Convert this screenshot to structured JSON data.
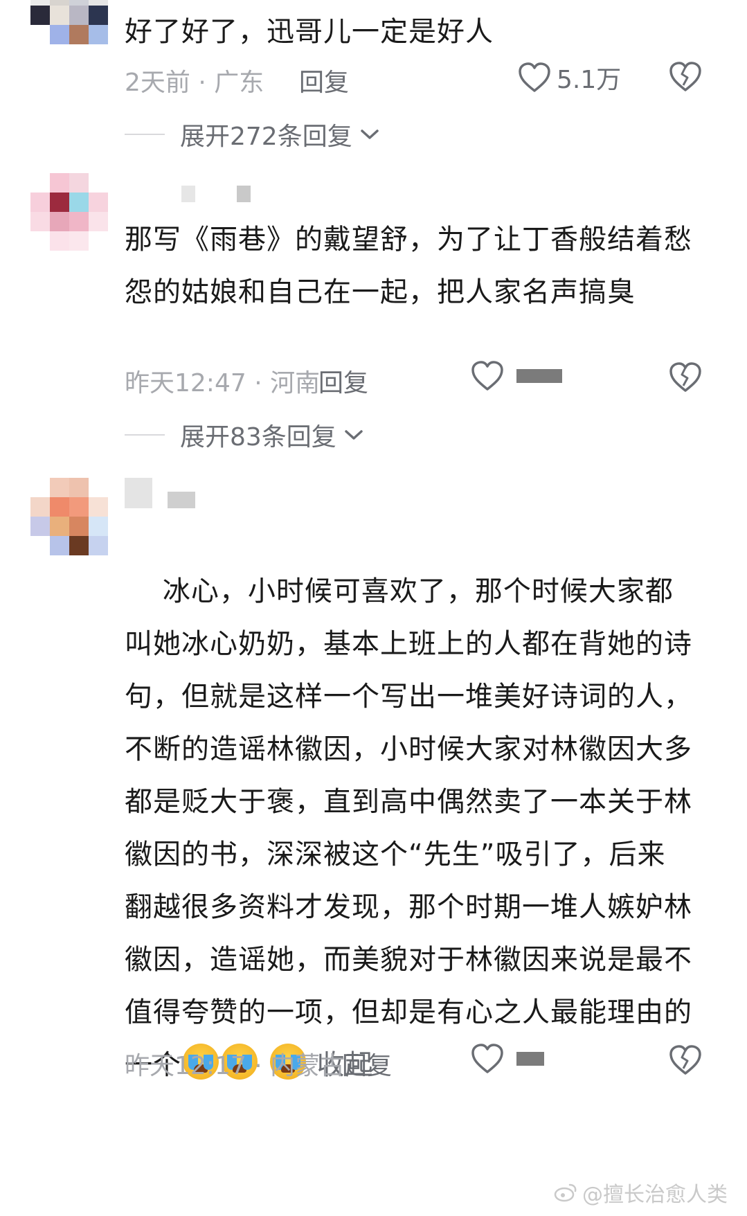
{
  "comments": [
    {
      "text": "好了好了，迅哥儿一定是好人",
      "meta": "2天前 · 广东",
      "reply_label": "回复",
      "likes": "5.1万",
      "expand_label": "展开272条回复"
    },
    {
      "text": "那写《雨巷》的戴望舒，为了让丁香般结着愁怨的姑娘和自己在一起，把人家名声搞臭",
      "meta": "昨天12:47 · 河南",
      "reply_label": "回复",
      "expand_label": "展开83条回复"
    },
    {
      "text": "冰心，小时候可喜欢了，那个时候大家都叫她冰心奶奶，基本上班上的人都在背她的诗句，但就是这样一个写出一堆美好诗词的人，不断的造谣林徽因，小时候大家对林徽因大多都是贬大于褒，直到高中偶然卖了一本关于林徽因的书，深深被这个“先生”吸引了，后来翻越很多资料才发现，那个时期一堆人嫉妒林徽因，造谣她，而美貌对于林徽因来说是最不值得夸赞的一项，但却是有心之人最能理由的一个",
      "collapse_label": "收起",
      "meta": "昨天12:17 · 内蒙古",
      "reply_label": "回复"
    }
  ],
  "icons": {
    "like": "heart-outline-icon",
    "dislike": "broken-heart-icon",
    "expand": "chevron-down-icon",
    "emoji": "crying-face-emoji"
  },
  "watermark": "@擅长治愈人类",
  "colors": {
    "text": "#1a1a1a",
    "meta": "#a7a9ae",
    "action": "#6a6d73",
    "divider": "#d9d9dc"
  }
}
